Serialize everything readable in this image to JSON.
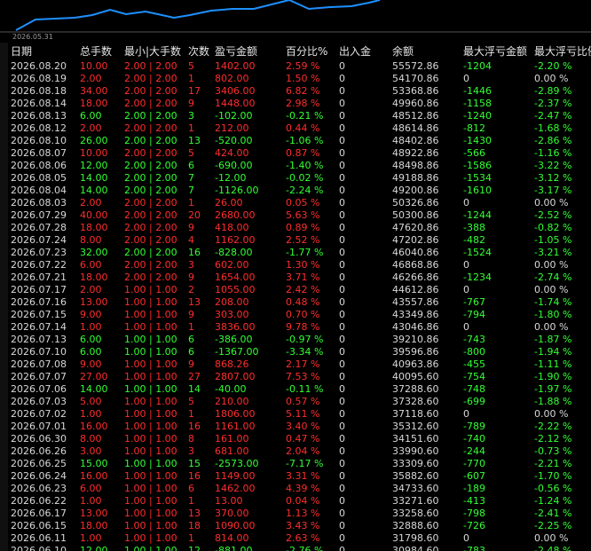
{
  "chart": {
    "date_label": "2026.05.31",
    "line_color": "#1e90ff",
    "baseline_color": "#666666"
  },
  "colors": {
    "positive": "#ff2d2d",
    "negative": "#33ff33",
    "neutral": "#d8d8d8",
    "background": "#000000"
  },
  "table": {
    "headers": [
      "日期",
      "总手数",
      "最小|大手数",
      "次数",
      "盈亏金额",
      "百分比%",
      "出入金",
      "余额",
      "最大浮亏金额",
      "最大浮亏比例"
    ],
    "rows": [
      [
        "2026.08.20",
        "10.00",
        "2.00 | 2.00",
        "5",
        "1402.00",
        "2.59 %",
        "0",
        "55572.86",
        "-1204",
        "-2.20 %",
        "pos"
      ],
      [
        "2026.08.19",
        "2.00",
        "2.00 | 2.00",
        "1",
        "802.00",
        "1.50 %",
        "0",
        "54170.86",
        "0",
        "0.00 %",
        "pos"
      ],
      [
        "2026.08.18",
        "34.00",
        "2.00 | 2.00",
        "17",
        "3406.00",
        "6.82 %",
        "0",
        "53368.86",
        "-1446",
        "-2.89 %",
        "pos"
      ],
      [
        "2026.08.14",
        "18.00",
        "2.00 | 2.00",
        "9",
        "1448.00",
        "2.98 %",
        "0",
        "49960.86",
        "-1158",
        "-2.37 %",
        "pos"
      ],
      [
        "2026.08.13",
        "6.00",
        "2.00 | 2.00",
        "3",
        "-102.00",
        "-0.21 %",
        "0",
        "48512.86",
        "-1240",
        "-2.47 %",
        "neg"
      ],
      [
        "2026.08.12",
        "2.00",
        "2.00 | 2.00",
        "1",
        "212.00",
        "0.44 %",
        "0",
        "48614.86",
        "-812",
        "-1.68 %",
        "pos"
      ],
      [
        "2026.08.10",
        "26.00",
        "2.00 | 2.00",
        "13",
        "-520.00",
        "-1.06 %",
        "0",
        "48402.86",
        "-1430",
        "-2.86 %",
        "neg"
      ],
      [
        "2026.08.07",
        "10.00",
        "2.00 | 2.00",
        "5",
        "424.00",
        "0.87 %",
        "0",
        "48922.86",
        "-566",
        "-1.16 %",
        "pos"
      ],
      [
        "2026.08.06",
        "12.00",
        "2.00 | 2.00",
        "6",
        "-690.00",
        "-1.40 %",
        "0",
        "48498.86",
        "-1586",
        "-3.22 %",
        "neg"
      ],
      [
        "2026.08.05",
        "14.00",
        "2.00 | 2.00",
        "7",
        "-12.00",
        "-0.02 %",
        "0",
        "49188.86",
        "-1534",
        "-3.12 %",
        "neg"
      ],
      [
        "2026.08.04",
        "14.00",
        "2.00 | 2.00",
        "7",
        "-1126.00",
        "-2.24 %",
        "0",
        "49200.86",
        "-1610",
        "-3.17 %",
        "neg"
      ],
      [
        "2026.08.03",
        "2.00",
        "2.00 | 2.00",
        "1",
        "26.00",
        "0.05 %",
        "0",
        "50326.86",
        "0",
        "0.00 %",
        "pos"
      ],
      [
        "2026.07.29",
        "40.00",
        "2.00 | 2.00",
        "20",
        "2680.00",
        "5.63 %",
        "0",
        "50300.86",
        "-1244",
        "-2.52 %",
        "pos"
      ],
      [
        "2026.07.28",
        "18.00",
        "2.00 | 2.00",
        "9",
        "418.00",
        "0.89 %",
        "0",
        "47620.86",
        "-388",
        "-0.82 %",
        "pos"
      ],
      [
        "2026.07.24",
        "8.00",
        "2.00 | 2.00",
        "4",
        "1162.00",
        "2.52 %",
        "0",
        "47202.86",
        "-482",
        "-1.05 %",
        "pos"
      ],
      [
        "2026.07.23",
        "32.00",
        "2.00 | 2.00",
        "16",
        "-828.00",
        "-1.77 %",
        "0",
        "46040.86",
        "-1524",
        "-3.21 %",
        "neg"
      ],
      [
        "2026.07.22",
        "6.00",
        "2.00 | 2.00",
        "3",
        "602.00",
        "1.30 %",
        "0",
        "46868.86",
        "0",
        "0.00 %",
        "pos"
      ],
      [
        "2026.07.21",
        "18.00",
        "2.00 | 2.00",
        "9",
        "1654.00",
        "3.71 %",
        "0",
        "46266.86",
        "-1234",
        "-2.74 %",
        "pos"
      ],
      [
        "2026.07.17",
        "2.00",
        "1.00 | 1.00",
        "2",
        "1055.00",
        "2.42 %",
        "0",
        "44612.86",
        "0",
        "0.00 %",
        "pos"
      ],
      [
        "2026.07.16",
        "13.00",
        "1.00 | 1.00",
        "13",
        "208.00",
        "0.48 %",
        "0",
        "43557.86",
        "-767",
        "-1.74 %",
        "pos"
      ],
      [
        "2026.07.15",
        "9.00",
        "1.00 | 1.00",
        "9",
        "303.00",
        "0.70 %",
        "0",
        "43349.86",
        "-794",
        "-1.80 %",
        "pos"
      ],
      [
        "2026.07.14",
        "1.00",
        "1.00 | 1.00",
        "1",
        "3836.00",
        "9.78 %",
        "0",
        "43046.86",
        "0",
        "0.00 %",
        "pos"
      ],
      [
        "2026.07.13",
        "6.00",
        "1.00 | 1.00",
        "6",
        "-386.00",
        "-0.97 %",
        "0",
        "39210.86",
        "-743",
        "-1.87 %",
        "neg"
      ],
      [
        "2026.07.10",
        "6.00",
        "1.00 | 1.00",
        "6",
        "-1367.00",
        "-3.34 %",
        "0",
        "39596.86",
        "-800",
        "-1.94 %",
        "neg"
      ],
      [
        "2026.07.08",
        "9.00",
        "1.00 | 1.00",
        "9",
        "868.26",
        "2.17 %",
        "0",
        "40963.86",
        "-455",
        "-1.11 %",
        "pos"
      ],
      [
        "2026.07.07",
        "27.00",
        "1.00 | 1.00",
        "27",
        "2807.00",
        "7.53 %",
        "0",
        "40095.60",
        "-754",
        "-1.90 %",
        "pos"
      ],
      [
        "2026.07.06",
        "14.00",
        "1.00 | 1.00",
        "14",
        "-40.00",
        "-0.11 %",
        "0",
        "37288.60",
        "-748",
        "-1.97 %",
        "neg"
      ],
      [
        "2026.07.03",
        "5.00",
        "1.00 | 1.00",
        "5",
        "210.00",
        "0.57 %",
        "0",
        "37328.60",
        "-699",
        "-1.88 %",
        "pos"
      ],
      [
        "2026.07.02",
        "1.00",
        "1.00 | 1.00",
        "1",
        "1806.00",
        "5.11 %",
        "0",
        "37118.60",
        "0",
        "0.00 %",
        "pos"
      ],
      [
        "2026.07.01",
        "16.00",
        "1.00 | 1.00",
        "16",
        "1161.00",
        "3.40 %",
        "0",
        "35312.60",
        "-789",
        "-2.22 %",
        "pos"
      ],
      [
        "2026.06.30",
        "8.00",
        "1.00 | 1.00",
        "8",
        "161.00",
        "0.47 %",
        "0",
        "34151.60",
        "-740",
        "-2.12 %",
        "pos"
      ],
      [
        "2026.06.26",
        "3.00",
        "1.00 | 1.00",
        "3",
        "681.00",
        "2.04 %",
        "0",
        "33990.60",
        "-244",
        "-0.73 %",
        "pos"
      ],
      [
        "2026.06.25",
        "15.00",
        "1.00 | 1.00",
        "15",
        "-2573.00",
        "-7.17 %",
        "0",
        "33309.60",
        "-770",
        "-2.21 %",
        "neg"
      ],
      [
        "2026.06.24",
        "16.00",
        "1.00 | 1.00",
        "16",
        "1149.00",
        "3.31 %",
        "0",
        "35882.60",
        "-607",
        "-1.70 %",
        "pos"
      ],
      [
        "2026.06.23",
        "6.00",
        "1.00 | 1.00",
        "6",
        "1462.00",
        "4.39 %",
        "0",
        "34733.60",
        "-189",
        "-0.56 %",
        "pos"
      ],
      [
        "2026.06.22",
        "1.00",
        "1.00 | 1.00",
        "1",
        "13.00",
        "0.04 %",
        "0",
        "33271.60",
        "-413",
        "-1.24 %",
        "pos"
      ],
      [
        "2026.06.17",
        "13.00",
        "1.00 | 1.00",
        "13",
        "370.00",
        "1.13 %",
        "0",
        "33258.60",
        "-798",
        "-2.41 %",
        "pos"
      ],
      [
        "2026.06.15",
        "18.00",
        "1.00 | 1.00",
        "18",
        "1090.00",
        "3.43 %",
        "0",
        "32888.60",
        "-726",
        "-2.25 %",
        "pos"
      ],
      [
        "2026.06.11",
        "1.00",
        "1.00 | 1.00",
        "1",
        "814.00",
        "2.63 %",
        "0",
        "31798.60",
        "0",
        "0.00 %",
        "pos"
      ],
      [
        "2026.06.10",
        "12.00",
        "1.00 | 1.00",
        "12",
        "-881.00",
        "-2.76 %",
        "0",
        "30984.60",
        "-783",
        "-2.48 %",
        "neg"
      ]
    ]
  }
}
